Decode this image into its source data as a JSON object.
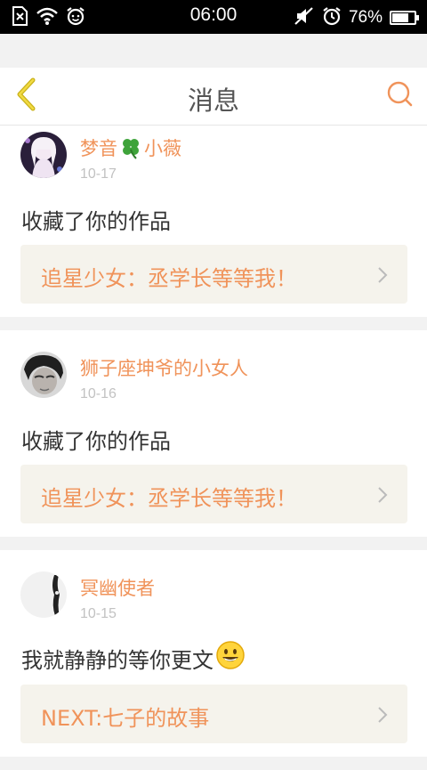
{
  "status_bar": {
    "time": "06:00",
    "battery_percent": "76%",
    "battery_level": 0.76,
    "left_icons": [
      "sim-error-icon",
      "wifi-icon",
      "alarm-clock-icon"
    ],
    "right_icons": [
      "mute-icon",
      "alarm-icon",
      "battery-icon"
    ]
  },
  "header": {
    "title": "消息",
    "back_icon": "chevron-left-icon",
    "search_icon": "search-icon",
    "accent_color": "#f0935a"
  },
  "notifications": [
    {
      "user_name_prefix": "梦音",
      "user_name_suffix": "小薇",
      "name_emoji": "four-leaf-clover-icon",
      "date": "10-17",
      "message": "收藏了你的作品",
      "work_title": "追星少女：丞学长等等我！"
    },
    {
      "user_name": "狮子座坤爷的小女人",
      "date": "10-16",
      "message": "收藏了你的作品",
      "work_title": "追星少女：丞学长等等我！"
    },
    {
      "user_name": "冥幽使者",
      "date": "10-15",
      "message": "我就静静的等你更文",
      "message_emoji": "smiley-face-icon",
      "work_title": "NEXT:七子的故事"
    }
  ]
}
